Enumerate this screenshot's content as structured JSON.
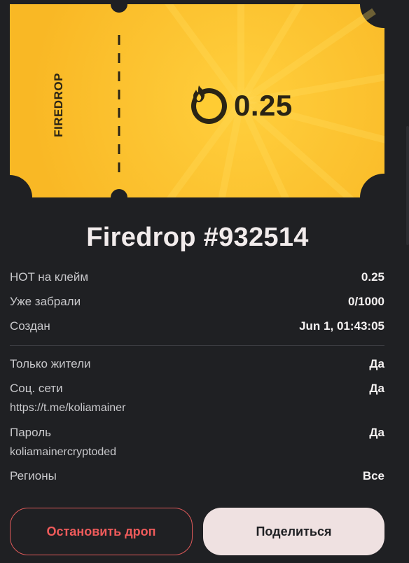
{
  "ticket": {
    "brand": "FIREDROP",
    "amount": "0.25",
    "coin_icon": "fire-coin-icon"
  },
  "title": "Firedrop #932514",
  "details": {
    "hot_per_claim": {
      "label": "HOT на клейм",
      "value": "0.25"
    },
    "claimed": {
      "label": "Уже забрали",
      "value": "0/1000"
    },
    "created": {
      "label": "Создан",
      "value": "Jun 1, 01:43:05"
    },
    "residents_only": {
      "label": "Только жители",
      "value": "Да"
    },
    "socials": {
      "label": "Соц. сети",
      "value": "Да",
      "detail": "https://t.me/koliamainer"
    },
    "password": {
      "label": "Пароль",
      "value": "Да",
      "detail": "koliamainercryptoded"
    },
    "regions": {
      "label": "Регионы",
      "value": "Все"
    }
  },
  "buttons": {
    "stop": "Остановить дроп",
    "share": "Поделиться"
  },
  "colors": {
    "background": "#1f2023",
    "ticket": "#fbbb2a",
    "danger": "#ef5b5b",
    "share_bg": "#efe1e1"
  }
}
